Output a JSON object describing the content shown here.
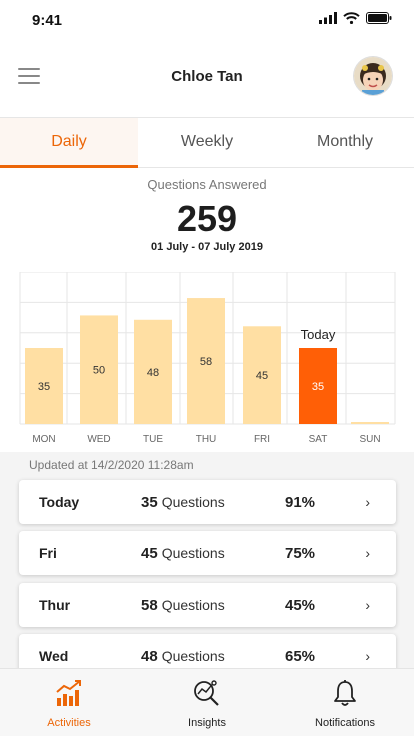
{
  "status_bar": {
    "time": "9:41"
  },
  "header": {
    "title": "Chloe Tan"
  },
  "tabs": [
    {
      "label": "Daily",
      "active": true
    },
    {
      "label": "Weekly",
      "active": false
    },
    {
      "label": "Monthly",
      "active": false
    }
  ],
  "summary": {
    "label": "Questions Answered",
    "total": "259",
    "range": "01 July - 07 July 2019"
  },
  "colors": {
    "accent": "#ec6608",
    "bar": "#ffdfa3",
    "bar_today": "#ff5f06"
  },
  "chart_data": {
    "type": "bar",
    "categories": [
      "MON",
      "WED",
      "TUE",
      "THU",
      "FRI",
      "SAT",
      "SUN"
    ],
    "values": [
      35,
      50,
      48,
      58,
      45,
      35,
      0
    ],
    "highlight_index": 5,
    "highlight_label": "Today",
    "ylim": [
      0,
      70
    ],
    "grid": true
  },
  "updated_text": "Updated at 14/2/2020   11:28am",
  "day_list": {
    "unit": "Questions",
    "items": [
      {
        "day": "Today",
        "count": "35",
        "percent": "91%"
      },
      {
        "day": "Fri",
        "count": "45",
        "percent": "75%"
      },
      {
        "day": "Thur",
        "count": "58",
        "percent": "45%"
      },
      {
        "day": "Wed",
        "count": "48",
        "percent": "65%"
      }
    ]
  },
  "bottom_nav": [
    {
      "label": "Activities",
      "icon": "activities-chart-icon",
      "active": true
    },
    {
      "label": "Insights",
      "icon": "insights-magnifier-icon",
      "active": false
    },
    {
      "label": "Notifications",
      "icon": "bell-icon",
      "active": false
    }
  ]
}
